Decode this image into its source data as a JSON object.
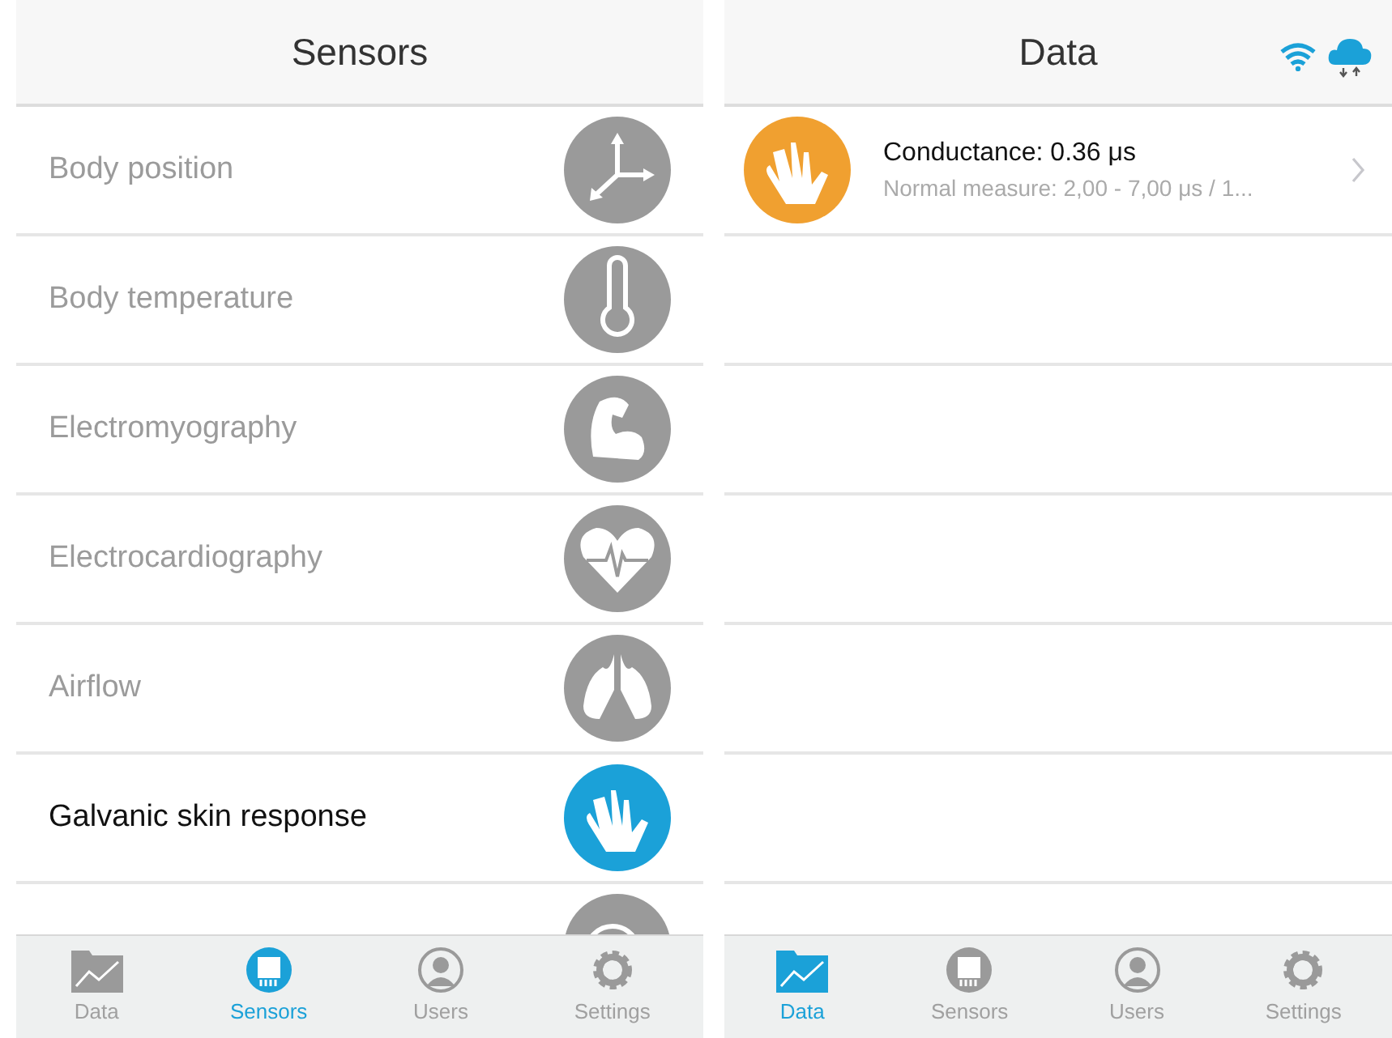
{
  "sensors_screen": {
    "title": "Sensors",
    "items": [
      {
        "label": "Body position",
        "kind": "axes",
        "selected": false
      },
      {
        "label": "Body temperature",
        "kind": "thermometer",
        "selected": false
      },
      {
        "label": "Electromyography",
        "kind": "muscle",
        "selected": false
      },
      {
        "label": "Electrocardiography",
        "kind": "heart",
        "selected": false
      },
      {
        "label": "Airflow",
        "kind": "lungs",
        "selected": false
      },
      {
        "label": "Galvanic skin response",
        "kind": "hand",
        "selected": true
      },
      {
        "kind": "gauge",
        "selected": false
      }
    ],
    "tabs": [
      {
        "label": "Data",
        "kind": "chart",
        "selected": false
      },
      {
        "label": "Sensors",
        "kind": "chip",
        "selected": true
      },
      {
        "label": "Users",
        "kind": "user",
        "selected": false
      },
      {
        "label": "Settings",
        "kind": "gear",
        "selected": false
      }
    ]
  },
  "data_screen": {
    "title": "Data",
    "readings": [
      {
        "title": "Conductance: 0.36 μs",
        "subtitle": "Normal measure: 2,00 - 7,00 μs / 1...",
        "kind": "hand",
        "color": "#f0a030"
      }
    ],
    "tabs": [
      {
        "label": "Data",
        "kind": "chart",
        "selected": true
      },
      {
        "label": "Sensors",
        "kind": "chip",
        "selected": false
      },
      {
        "label": "Users",
        "kind": "user",
        "selected": false
      },
      {
        "label": "Settings",
        "kind": "gear",
        "selected": false
      }
    ]
  }
}
